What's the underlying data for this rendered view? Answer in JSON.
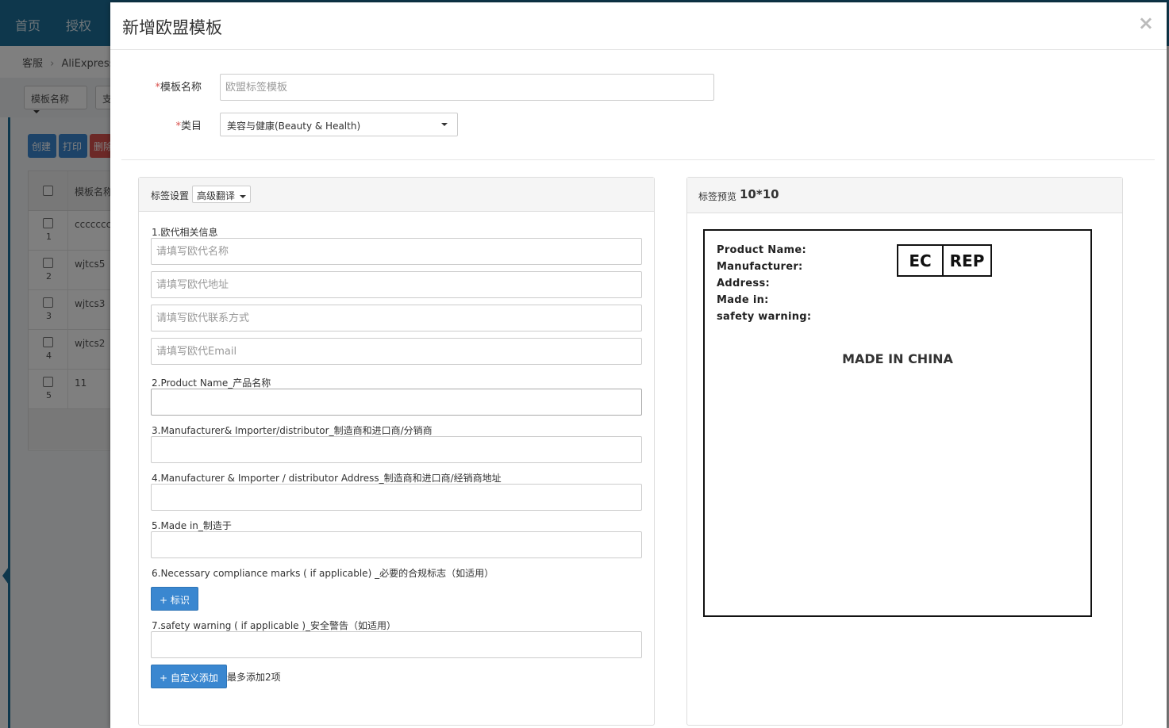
{
  "background": {
    "nav": [
      "首页",
      "授权"
    ],
    "breadcrumb": [
      "客服",
      "AliExpress"
    ],
    "filters": [
      "模板名称",
      "支"
    ],
    "buttons": [
      "创建",
      "打印",
      "删除"
    ],
    "table": {
      "header": "模板名称",
      "rows": [
        {
          "num": "1",
          "name": "ccccccccc"
        },
        {
          "num": "2",
          "name": "wjtcs5"
        },
        {
          "num": "3",
          "name": "wjtcs3"
        },
        {
          "num": "4",
          "name": "wjtcs2"
        },
        {
          "num": "5",
          "name": "11"
        }
      ]
    }
  },
  "modal": {
    "title": "新增欧盟模板",
    "close_icon": "×",
    "template_name": {
      "label": "模板名称",
      "required_mark": "*",
      "value": "",
      "placeholder": "欧盟标签模板"
    },
    "category": {
      "label": "类目",
      "required_mark": "*",
      "selected": "美容与健康(Beauty & Health)"
    },
    "settings_panel": {
      "title": "标签设置",
      "translate_button": "高级翻译",
      "sections": {
        "eu_rep": {
          "label": "1.欧代相关信息",
          "name_placeholder": "请填写欧代名称",
          "address_placeholder": "请填写欧代地址",
          "contact_placeholder": "请填写欧代联系方式",
          "email_placeholder": "请填写欧代Email"
        },
        "product_name": {
          "label": "2.Product Name_产品名称",
          "value": ""
        },
        "manufacturer": {
          "label": "3.Manufacturer& Importer/distributor_制造商和进口商/分销商",
          "value": ""
        },
        "manufacturer_address": {
          "label": "4.Manufacturer & Importer / distributor Address_制造商和进口商/经销商地址",
          "value": ""
        },
        "made_in": {
          "label": "5.Made in_制造于",
          "value": ""
        },
        "compliance": {
          "label": "6.Necessary compliance marks ( if applicable) _必要的合规标志（如适用）",
          "button": "+ 标识"
        },
        "safety": {
          "label": "7.safety warning ( if applicable )_安全警告（如适用）",
          "value": ""
        }
      },
      "custom_add_button": "+ 自定义添加",
      "custom_add_hint": "最多添加2项"
    },
    "preview_panel": {
      "title": "标签预览",
      "size": "10*10",
      "fields": [
        "Product Name:",
        "Manufacturer:",
        "Address:",
        "Made in:",
        "safety warning:"
      ],
      "ec_rep": {
        "left": "EC",
        "right": "REP"
      },
      "made_in_china": "MADE IN CHINA"
    }
  }
}
